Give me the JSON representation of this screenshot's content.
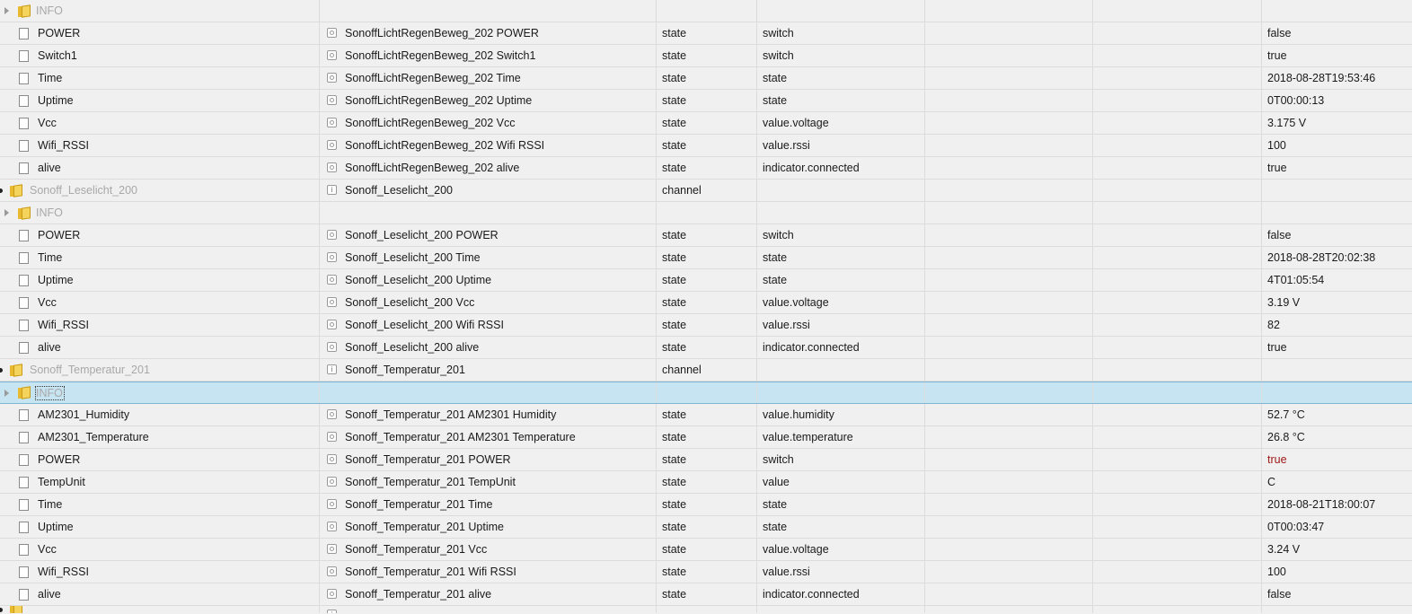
{
  "rows": [
    {
      "kind": "folder",
      "indent": 1,
      "id": "INFO",
      "name": "",
      "type": "",
      "role": "",
      "value": "",
      "expander": true
    },
    {
      "kind": "state",
      "id": "POWER",
      "name": "SonoffLichtRegenBeweg_202 POWER",
      "type": "state",
      "role": "switch",
      "value": "false"
    },
    {
      "kind": "state",
      "id": "Switch1",
      "name": "SonoffLichtRegenBeweg_202 Switch1",
      "type": "state",
      "role": "switch",
      "value": "true"
    },
    {
      "kind": "state",
      "id": "Time",
      "name": "SonoffLichtRegenBeweg_202 Time",
      "type": "state",
      "role": "state",
      "value": "2018-08-28T19:53:46"
    },
    {
      "kind": "state",
      "id": "Uptime",
      "name": "SonoffLichtRegenBeweg_202 Uptime",
      "type": "state",
      "role": "state",
      "value": "0T00:00:13"
    },
    {
      "kind": "state",
      "id": "Vcc",
      "name": "SonoffLichtRegenBeweg_202 Vcc",
      "type": "state",
      "role": "value.voltage",
      "value": "3.175 V"
    },
    {
      "kind": "state",
      "id": "Wifi_RSSI",
      "name": "SonoffLichtRegenBeweg_202 Wifi RSSI",
      "type": "state",
      "role": "value.rssi",
      "value": "100"
    },
    {
      "kind": "state",
      "id": "alive",
      "name": "SonoffLichtRegenBeweg_202 alive",
      "type": "state",
      "role": "indicator.connected",
      "value": "true"
    },
    {
      "kind": "channel",
      "id": "Sonoff_Leselicht_200",
      "name": "Sonoff_Leselicht_200",
      "type": "channel",
      "role": "",
      "value": ""
    },
    {
      "kind": "folder",
      "indent": 1,
      "id": "INFO",
      "name": "",
      "type": "",
      "role": "",
      "value": "",
      "expander": true
    },
    {
      "kind": "state",
      "id": "POWER",
      "name": "Sonoff_Leselicht_200 POWER",
      "type": "state",
      "role": "switch",
      "value": "false"
    },
    {
      "kind": "state",
      "id": "Time",
      "name": "Sonoff_Leselicht_200 Time",
      "type": "state",
      "role": "state",
      "value": "2018-08-28T20:02:38"
    },
    {
      "kind": "state",
      "id": "Uptime",
      "name": "Sonoff_Leselicht_200 Uptime",
      "type": "state",
      "role": "state",
      "value": "4T01:05:54"
    },
    {
      "kind": "state",
      "id": "Vcc",
      "name": "Sonoff_Leselicht_200 Vcc",
      "type": "state",
      "role": "value.voltage",
      "value": "3.19 V"
    },
    {
      "kind": "state",
      "id": "Wifi_RSSI",
      "name": "Sonoff_Leselicht_200 Wifi RSSI",
      "type": "state",
      "role": "value.rssi",
      "value": "82"
    },
    {
      "kind": "state",
      "id": "alive",
      "name": "Sonoff_Leselicht_200 alive",
      "type": "state",
      "role": "indicator.connected",
      "value": "true"
    },
    {
      "kind": "channel",
      "id": "Sonoff_Temperatur_201",
      "name": "Sonoff_Temperatur_201",
      "type": "channel",
      "role": "",
      "value": ""
    },
    {
      "kind": "folder",
      "indent": 1,
      "id": "INFO",
      "name": "",
      "type": "",
      "role": "",
      "value": "",
      "expander": true,
      "selected": true
    },
    {
      "kind": "state",
      "id": "AM2301_Humidity",
      "name": "Sonoff_Temperatur_201 AM2301 Humidity",
      "type": "state",
      "role": "value.humidity",
      "value": "52.7 °C"
    },
    {
      "kind": "state",
      "id": "AM2301_Temperature",
      "name": "Sonoff_Temperatur_201 AM2301 Temperature",
      "type": "state",
      "role": "value.temperature",
      "value": "26.8 °C"
    },
    {
      "kind": "state",
      "id": "POWER",
      "name": "Sonoff_Temperatur_201 POWER",
      "type": "state",
      "role": "switch",
      "value": "true",
      "value_color": "red"
    },
    {
      "kind": "state",
      "id": "TempUnit",
      "name": "Sonoff_Temperatur_201 TempUnit",
      "type": "state",
      "role": "value",
      "value": "C"
    },
    {
      "kind": "state",
      "id": "Time",
      "name": "Sonoff_Temperatur_201 Time",
      "type": "state",
      "role": "state",
      "value": "2018-08-21T18:00:07"
    },
    {
      "kind": "state",
      "id": "Uptime",
      "name": "Sonoff_Temperatur_201 Uptime",
      "type": "state",
      "role": "state",
      "value": "0T00:03:47"
    },
    {
      "kind": "state",
      "id": "Vcc",
      "name": "Sonoff_Temperatur_201 Vcc",
      "type": "state",
      "role": "value.voltage",
      "value": "3.24 V"
    },
    {
      "kind": "state",
      "id": "Wifi_RSSI",
      "name": "Sonoff_Temperatur_201 Wifi RSSI",
      "type": "state",
      "role": "value.rssi",
      "value": "100"
    },
    {
      "kind": "state",
      "id": "alive",
      "name": "Sonoff_Temperatur_201 alive",
      "type": "state",
      "role": "indicator.connected",
      "value": "false"
    },
    {
      "kind": "channel",
      "id": "",
      "name": "",
      "type": "",
      "role": "",
      "value": "",
      "partial": true
    }
  ],
  "colors": {
    "selected_bg": "#c7e4f2",
    "folder": "#f5d45e",
    "red_value": "#a01818",
    "muted_text": "#a8a8a8"
  }
}
